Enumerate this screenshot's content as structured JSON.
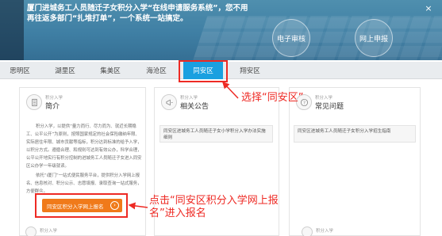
{
  "hero": {
    "text": "厦门进城务工人员随迁子女积分入学“在线申请服务系统”，您不用再往返多部门“扎堆打单”，一个系统一站搞定。",
    "btn_review": "电子审核",
    "btn_apply": "网上申报",
    "close": "×"
  },
  "tabs": [
    {
      "label": "思明区"
    },
    {
      "label": "湖里区"
    },
    {
      "label": "集美区"
    },
    {
      "label": "海沧区"
    },
    {
      "label": "同安区"
    },
    {
      "label": "翔安区"
    }
  ],
  "cards": {
    "intro": {
      "sub": "积分入学",
      "title": "简介",
      "para1": "积分入学，以提供“量力而行、尽力而为、就近长期稳工、公平公开”为原则，按照国家规定的社会保险缴纳年限、实际居住年限、城市贡献等指标，积分达到标准的给予入学，以积分方式。遵循合理、和规则可达到有效公办，科学合理，公平公开地实行有积分控制的进城务工人员随迁子女进入同安区公办学一年级就读。",
      "para2": "依托“i厦门”一站式便民服务平台，提供积分入学网上报名、信息核对、积分公示、志愿填报、录取查询一站式服务，方便群众。",
      "apply_button": "同安区积分入学网上报名"
    },
    "notice": {
      "sub": "积分入学",
      "title": "相关公告",
      "item": "同安区进城务工人员随迁子女小学积分入学办法实施细则"
    },
    "faq": {
      "sub": "积分入学",
      "title": "常见问题",
      "item": "同安区进城务工人员随迁子女积分入学招生指南"
    }
  },
  "bottom": {
    "left_sub": "积分入学",
    "right_sub": "积分入学"
  },
  "annotations": {
    "select_district": "选择“同安区”",
    "click_apply": "点击“同安区积分入学网上报名”进入报名"
  },
  "colors": {
    "active_tab": "#1aa0e0",
    "apply_button": "#f07a1a",
    "annotation_red": "#ee2a24"
  }
}
